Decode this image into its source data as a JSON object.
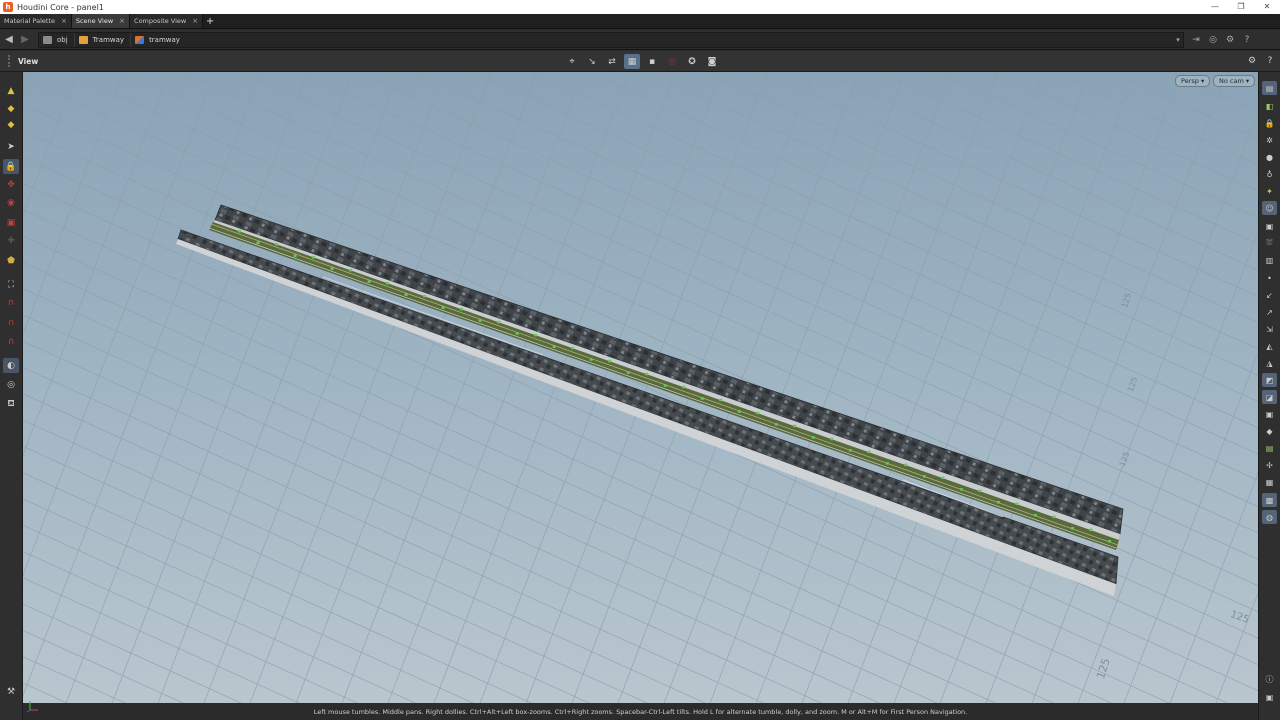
{
  "window": {
    "title": "Houdini Core - panel1",
    "controls": [
      "—",
      "❐",
      "✕"
    ]
  },
  "tabs": [
    {
      "label": "Material Palette",
      "active": false
    },
    {
      "label": "Scene View",
      "active": true
    },
    {
      "label": "Composite View",
      "active": false
    }
  ],
  "path": {
    "crumbs": [
      {
        "label": "obj",
        "icon": "obj-icon",
        "color": "#8a8a8a"
      },
      {
        "label": "Tramway",
        "icon": "subnet-icon",
        "color": "#e0a23a"
      },
      {
        "label": "tramway",
        "icon": "geometry-icon",
        "color": "#d8703a"
      }
    ]
  },
  "view": {
    "label": "View",
    "camera_menu": "Persp ▾",
    "cam_menu": "No cam ▾"
  },
  "viewport": {
    "axis_labels": [
      "125",
      "125",
      "-125",
      "125",
      "125"
    ]
  },
  "status": {
    "message": "Left mouse tumbles. Middle pans. Right dollies. Ctrl+Alt+Left box-zooms. Ctrl+Right zooms. Spacebar-Ctrl-Left tilts. Hold L for alternate tumble, dolly, and zoom.     M or Alt+M for First Person Navigation."
  },
  "colors": {
    "viewport_top": "#8aa3b6",
    "viewport_bottom": "#b9c6ce",
    "selected_tool": "#58708a",
    "brand": "#e8612c"
  }
}
